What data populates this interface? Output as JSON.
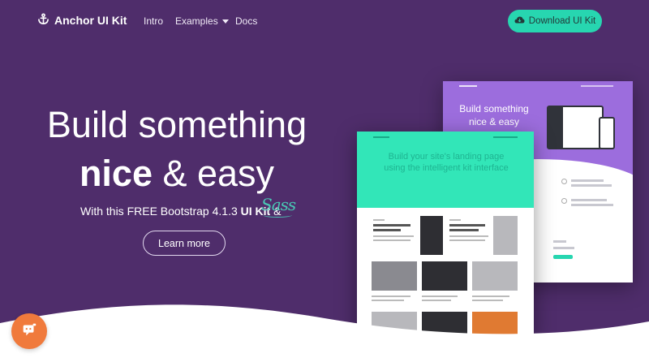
{
  "nav": {
    "brand": "Anchor UI Kit",
    "links": {
      "intro": "Intro",
      "examples": "Examples",
      "docs": "Docs"
    },
    "download_label": "Download UI Kit"
  },
  "hero": {
    "title_line1": "Build something",
    "title_line2_bold": "nice",
    "title_line2_rest": " & easy",
    "subtitle_pre": "With this FREE Bootstrap 4.1.3 ",
    "subtitle_bold": "UI Kit",
    "subtitle_post": " &",
    "sass_logo": "Sass",
    "cta_label": "Learn more"
  },
  "mockups": {
    "back_title": "Build something nice & easy",
    "front_text": "Build your site's landing page using the intelligent kit interface"
  },
  "colors": {
    "background": "#4f2d6b",
    "accent": "#27d6b0",
    "mock_purple": "#9c6ddd",
    "mock_teal": "#32e6b8",
    "chat": "#f07a3c"
  },
  "icons": [
    "anchor-icon",
    "chevron-down-icon",
    "cloud-download-icon",
    "chat-icon"
  ]
}
